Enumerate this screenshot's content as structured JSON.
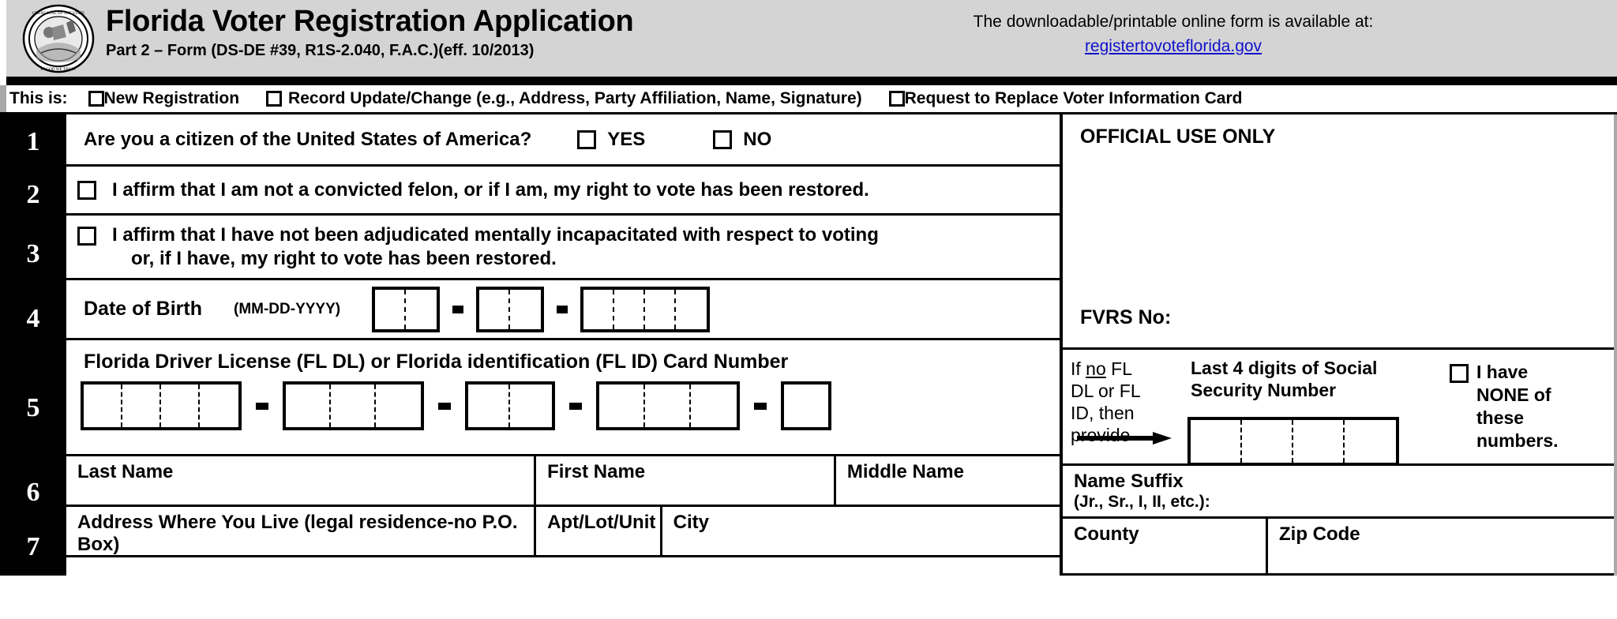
{
  "header": {
    "title": "Florida Voter Registration Application",
    "subtitle": "Part 2 – Form  (DS-DE #39, R1S-2.040, F.A.C.)(eff. 10/2013)",
    "note_line1": "The downloadable/printable online form is available at:",
    "link_text": "registertovoteflorida.gov",
    "seal_name": "florida-state-seal"
  },
  "this_is": {
    "label": "This is:",
    "options": [
      "New Registration",
      "Record Update/Change (e.g., Address, Party Affiliation, Name, Signature)",
      "Request to Replace Voter Information Card"
    ]
  },
  "rows": {
    "r1": {
      "num": "1",
      "question": "Are you a citizen of the United States of America?",
      "yes": "YES",
      "no": "NO"
    },
    "r2": {
      "num": "2",
      "text": "I affirm that I am not a convicted felon, or if I am, my right to vote has been restored."
    },
    "r3": {
      "num": "3",
      "line1": "I affirm that I have not been adjudicated mentally incapacitated with respect to voting",
      "line2": "or, if I have, my right to vote has been restored."
    },
    "r4": {
      "num": "4",
      "label": "Date of Birth",
      "format_hint": "(MM-DD-YYYY)",
      "segments": [
        2,
        2,
        4
      ]
    },
    "r5": {
      "num": "5",
      "title": "Florida Driver License (FL DL) or Florida identification (FL ID) Card Number",
      "segments": [
        4,
        3,
        2,
        3,
        1
      ],
      "if_no_text": "If no FL DL or FL ID, then provide",
      "if_no_underline_word": "no",
      "ssn_label": "Last 4 digits of Social Security Number",
      "ssn_digits": 4,
      "none_text": "I have NONE of these numbers."
    },
    "r6": {
      "num": "6",
      "fields": [
        {
          "label": "Last Name",
          "sub": ""
        },
        {
          "label": "First Name",
          "sub": ""
        },
        {
          "label": "Middle Name",
          "sub": ""
        },
        {
          "label": "Name Suffix",
          "sub": "(Jr., Sr., I, II, etc.):"
        }
      ]
    },
    "r7": {
      "num": "7",
      "fields": [
        {
          "label": "Address Where You Live (legal residence-no P.O. Box)"
        },
        {
          "label": "Apt/Lot/Unit"
        },
        {
          "label": "City"
        },
        {
          "label": "County"
        },
        {
          "label": "Zip Code"
        }
      ]
    }
  },
  "official": {
    "title": "OFFICIAL USE ONLY",
    "fvrs_label": "FVRS No:"
  },
  "colors": {
    "header_bg": "#d4d4d4",
    "rule": "#000000",
    "link": "#1111cc",
    "number_col": "#000000",
    "paper": "#ffffff"
  }
}
